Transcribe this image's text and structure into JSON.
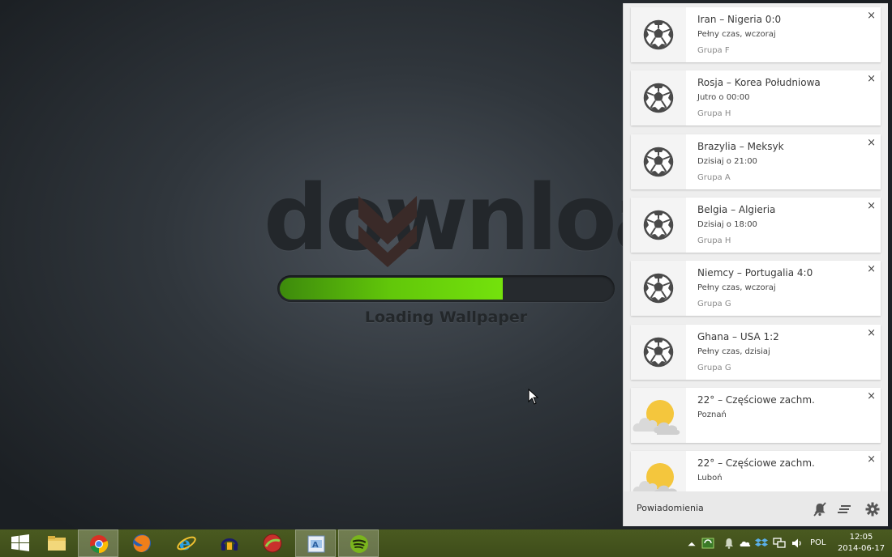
{
  "wallpaper": {
    "logo_text": "download",
    "progress": 0.67,
    "caption": "Loading Wallpaper"
  },
  "notifications": [
    {
      "icon": "soccer-ball-icon",
      "title": "Iran – Nigeria 0:0",
      "line2": "Pełny czas, wczoraj",
      "line3": "Grupa F"
    },
    {
      "icon": "soccer-ball-icon",
      "title": "Rosja – Korea Południowa",
      "line2": "Jutro o 00:00",
      "line3": "Grupa H"
    },
    {
      "icon": "soccer-ball-icon",
      "title": "Brazylia – Meksyk",
      "line2": "Dzisiaj o 21:00",
      "line3": "Grupa A"
    },
    {
      "icon": "soccer-ball-icon",
      "title": "Belgia – Algieria",
      "line2": "Dzisiaj o 18:00",
      "line3": "Grupa H"
    },
    {
      "icon": "soccer-ball-icon",
      "title": "Niemcy – Portugalia 4:0",
      "line2": "Pełny czas, wczoraj",
      "line3": "Grupa G"
    },
    {
      "icon": "soccer-ball-icon",
      "title": "Ghana – USA 1:2",
      "line2": "Pełny czas, dzisiaj",
      "line3": "Grupa G"
    },
    {
      "icon": "partly-cloudy-icon",
      "title": "22° – Częściowe zachm.",
      "line2": "Poznań",
      "line3": ""
    },
    {
      "icon": "partly-cloudy-icon",
      "title": "22° – Częściowe zachm.",
      "line2": "Luboń",
      "line3": ""
    }
  ],
  "notification_center": {
    "footer_title": "Powiadomienia",
    "close_glyph": "×"
  },
  "taskbar": {
    "apps": [
      {
        "name": "start-button",
        "icon": "windows-logo-icon"
      },
      {
        "name": "file-explorer",
        "icon": "folder-icon"
      },
      {
        "name": "chrome",
        "icon": "chrome-icon",
        "active": true
      },
      {
        "name": "firefox",
        "icon": "firefox-icon"
      },
      {
        "name": "internet-explorer",
        "icon": "ie-icon"
      },
      {
        "name": "audio-app",
        "icon": "headphones-icon"
      },
      {
        "name": "game-app",
        "icon": "round-app-icon"
      },
      {
        "name": "paint-app",
        "icon": "paint-icon",
        "active": true
      },
      {
        "name": "spotify",
        "icon": "spotify-icon",
        "active": true
      }
    ],
    "language": "POL",
    "time": "12:05",
    "date": "2014-06-17"
  },
  "colors": {
    "progress_green": "#6ad40b",
    "taskbar": "#435320",
    "panel_bg": "#eeeeee"
  }
}
